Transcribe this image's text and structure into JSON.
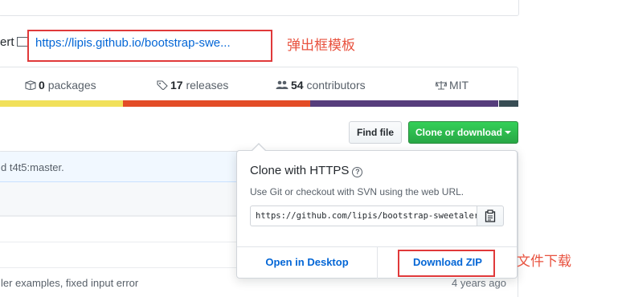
{
  "repo": {
    "description_fragment": "ert",
    "homepage_url": "https://lipis.github.io/bootstrap-swe..."
  },
  "annotations": {
    "popup_template": "弹出框模板",
    "file_download": "文件下载",
    "color": "#e8523f"
  },
  "stats": {
    "packages": {
      "count": "0",
      "label": "packages",
      "icon": "package-icon"
    },
    "releases": {
      "count": "17",
      "label": "releases",
      "icon": "tag-icon"
    },
    "contributors": {
      "count": "54",
      "label": "contributors",
      "icon": "people-icon"
    },
    "license": {
      "label": "MIT",
      "icon": "law-icon"
    }
  },
  "language_colors": [
    "#f1e05a",
    "#e34c26",
    "#563d7c",
    "#384d54"
  ],
  "actions": {
    "find_file": "Find file",
    "clone_or_download": "Clone or download"
  },
  "files": {
    "commit_text": "d t4t5:master.",
    "bottom_message": "ler examples, fixed input error",
    "bottom_age": "4 years ago"
  },
  "clone_popover": {
    "title": "Clone with HTTPS",
    "help_icon": "question-icon",
    "description": "Use Git or checkout with SVN using the web URL.",
    "url": "https://github.com/lipis/bootstrap-sweetalert.git",
    "copy_icon": "clipboard-icon",
    "open_desktop": "Open in Desktop",
    "download_zip": "Download ZIP"
  }
}
